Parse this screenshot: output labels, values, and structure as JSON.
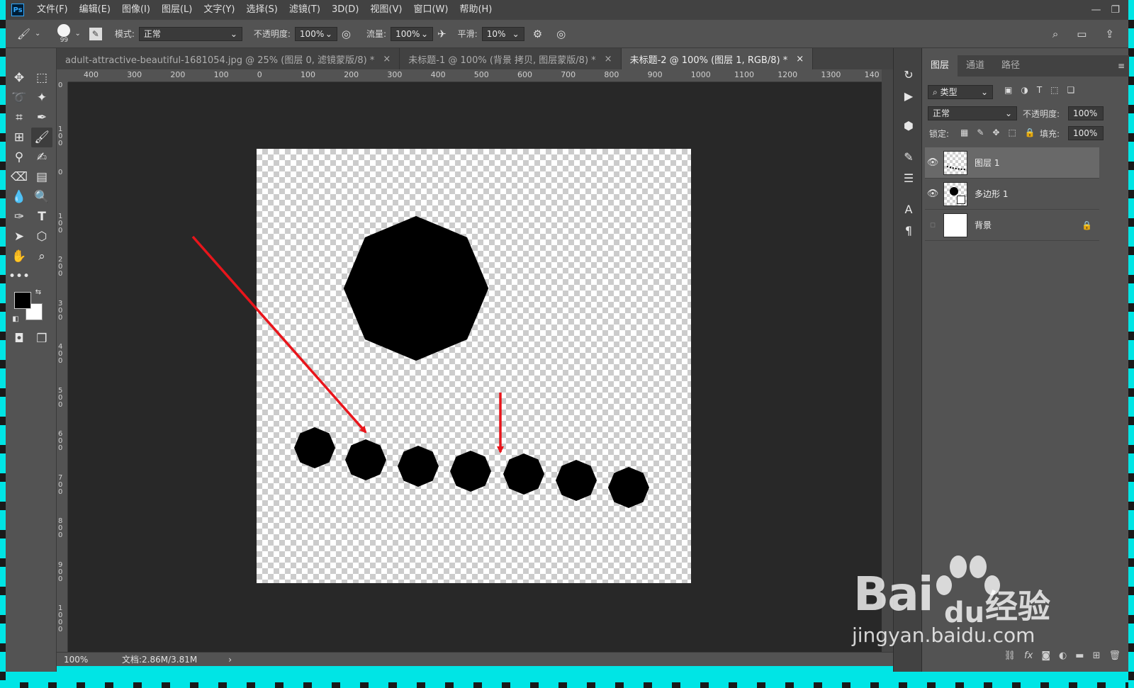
{
  "app": {
    "logo": "Ps"
  },
  "menu": [
    "文件(F)",
    "编辑(E)",
    "图像(I)",
    "图层(L)",
    "文字(Y)",
    "选择(S)",
    "滤镜(T)",
    "3D(D)",
    "视图(V)",
    "窗口(W)",
    "帮助(H)"
  ],
  "options": {
    "brush_size": "99",
    "mode_label": "模式:",
    "mode_value": "正常",
    "opacity_label": "不透明度:",
    "opacity_value": "100%",
    "flow_label": "流量:",
    "flow_value": "100%",
    "smooth_label": "平滑:",
    "smooth_value": "10%"
  },
  "tabs": [
    {
      "label": "adult-attractive-beautiful-1681054.jpg  @  25% (图层 0, 滤镜蒙版/8) *",
      "close": "×"
    },
    {
      "label": "未标题-1 @ 100% (背景 拷贝, 图层蒙版/8) *",
      "close": "×"
    },
    {
      "label": "未标题-2 @ 100% (图层 1, RGB/8) *",
      "close": "×"
    }
  ],
  "ruler_top": [
    "400",
    "300",
    "200",
    "100",
    "0",
    "100",
    "200",
    "300",
    "400",
    "500",
    "600",
    "700",
    "800",
    "900",
    "1000",
    "1100",
    "1200",
    "1300",
    "140"
  ],
  "ruler_left": [
    "0",
    "100",
    "0",
    "100",
    "200",
    "300",
    "400",
    "500",
    "600",
    "700",
    "800",
    "900",
    "1000"
  ],
  "status": {
    "zoom": "100%",
    "doc": "文档:2.86M/3.81M",
    "arrow": "›"
  },
  "layers_panel": {
    "tabs": [
      "图层",
      "通道",
      "路径"
    ],
    "filter_kind": "类型",
    "blend_mode": "正常",
    "opacity_label": "不透明度:",
    "opacity_value": "100%",
    "lock_label": "锁定:",
    "fill_label": "填充:",
    "fill_value": "100%",
    "layers": [
      {
        "name": "图层 1",
        "visible": true,
        "selected": true
      },
      {
        "name": "多边形 1",
        "visible": true,
        "selected": false
      },
      {
        "name": "背景",
        "visible": false,
        "selected": false,
        "locked": true
      }
    ]
  },
  "watermark": {
    "brand": "Bai",
    "brand_du": "du",
    "cn": "经验",
    "url": "jingyan.baidu.com"
  },
  "colors": {
    "shape": "#000000",
    "arrow": "#e8151b",
    "panel": "#535353",
    "workspace": "#282828"
  }
}
